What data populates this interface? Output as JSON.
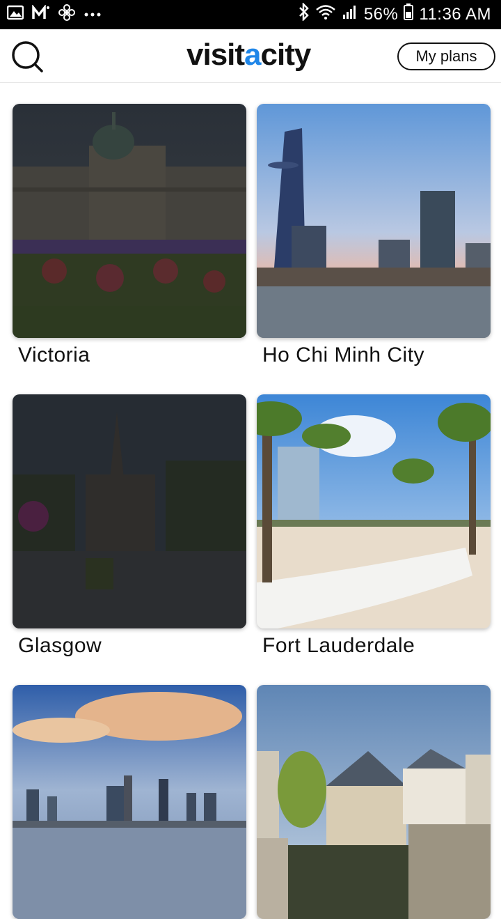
{
  "status_bar": {
    "battery": "56%",
    "time": "11:36 AM",
    "left_icons": [
      "gallery-icon",
      "gmail-icon",
      "fan-icon",
      "more-icon"
    ],
    "right_icons": [
      "bluetooth-icon",
      "wifi-icon",
      "signal-icon",
      "battery-icon"
    ]
  },
  "header": {
    "logo_prefix": "visit",
    "logo_accent": "a",
    "logo_suffix": "city",
    "my_plans": "My plans",
    "accent_color": "#1f86e8"
  },
  "cities": [
    {
      "name": "Victoria"
    },
    {
      "name": "Ho Chi Minh City"
    },
    {
      "name": "Glasgow"
    },
    {
      "name": "Fort Lauderdale"
    },
    {
      "name": ""
    },
    {
      "name": ""
    }
  ]
}
